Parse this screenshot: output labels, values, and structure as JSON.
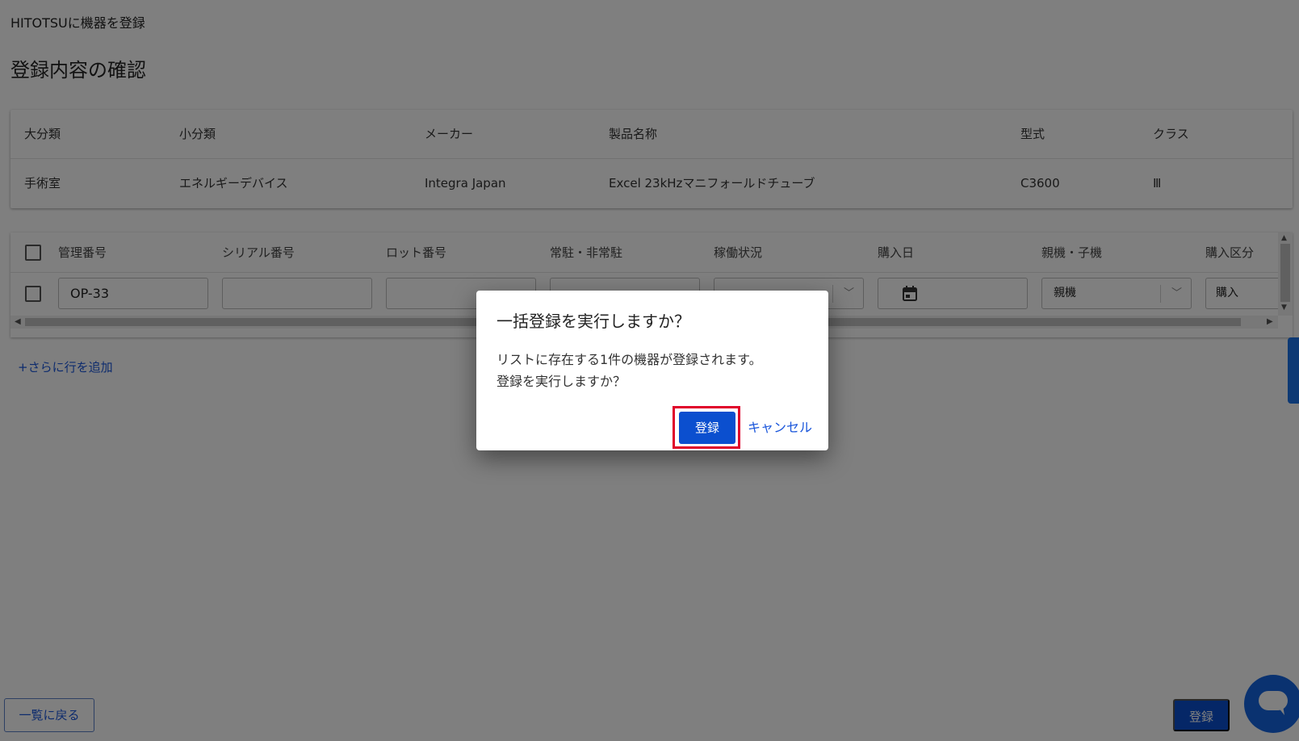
{
  "app_title": "HITOTSUに機器を登録",
  "section_title": "登録内容の確認",
  "product_info": {
    "headers": [
      "大分類",
      "小分類",
      "メーカー",
      "製品名称",
      "型式",
      "クラス"
    ],
    "values": [
      "手術室",
      "エネルギーデバイス",
      "Integra Japan",
      "Excel 23kHzマニフォールドチューブ",
      "C3600",
      "Ⅲ"
    ]
  },
  "device_table": {
    "headers": [
      "管理番号",
      "シリアル番号",
      "ロット番号",
      "常駐・非常駐",
      "稼働状況",
      "購入日",
      "親機・子機",
      "購入区分"
    ],
    "row": {
      "management_number": "OP-33",
      "serial_number": "",
      "lot_number": "",
      "resident": "",
      "status": "",
      "purchase_date": "",
      "parent_child": "親機",
      "purchase_type": "購入"
    }
  },
  "add_row_link": "+さらに行を追加",
  "back_button": "一覧に戻る",
  "register_button": "登録",
  "dialog": {
    "title": "一括登録を実行しますか？",
    "message_line1": "リストに存在する1件の機器が登録されます。",
    "message_line2": "登録を実行しますか？",
    "confirm_label": "登録",
    "cancel_label": "キャンセル"
  },
  "icons": {
    "calendar": "calendar-icon",
    "chevron": "chevron-down-icon",
    "chat": "chat-icon"
  },
  "colors": {
    "primary": "#0b4fcf",
    "link": "#1a56db",
    "highlight": "#e0002a"
  }
}
